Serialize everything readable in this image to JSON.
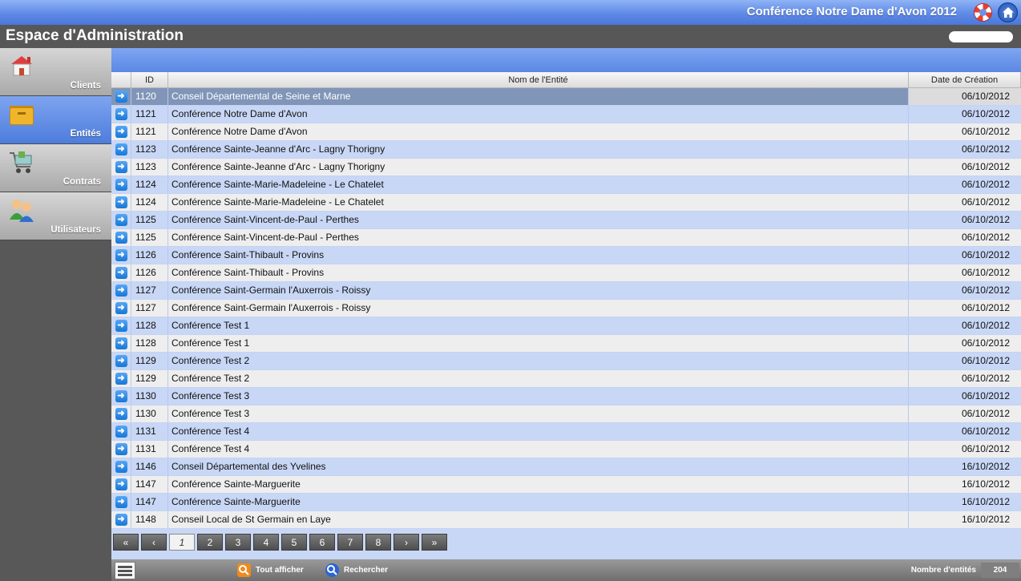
{
  "app": {
    "title": "Conférence Notre Dame d'Avon 2012",
    "page_title": "Espace d'Administration"
  },
  "sidebar": {
    "items": [
      {
        "label": "Clients",
        "icon": "house-icon"
      },
      {
        "label": "Entités",
        "icon": "folder-icon"
      },
      {
        "label": "Contrats",
        "icon": "cart-icon"
      },
      {
        "label": "Utilisateurs",
        "icon": "users-icon"
      }
    ]
  },
  "table": {
    "columns": [
      "ID",
      "Nom de l'Entité",
      "Date de Création"
    ],
    "rows": [
      {
        "id": "1120",
        "name": "Conseil Départemental de Seine et Marne",
        "date": "06/10/2012"
      },
      {
        "id": "1121",
        "name": "Conférence Notre Dame d'Avon",
        "date": "06/10/2012"
      },
      {
        "id": "1121",
        "name": "Conférence Notre Dame d'Avon",
        "date": "06/10/2012"
      },
      {
        "id": "1123",
        "name": "Conférence Sainte-Jeanne d'Arc - Lagny Thorigny",
        "date": "06/10/2012"
      },
      {
        "id": "1123",
        "name": "Conférence Sainte-Jeanne d'Arc - Lagny Thorigny",
        "date": "06/10/2012"
      },
      {
        "id": "1124",
        "name": "Conférence Sainte-Marie-Madeleine - Le Chatelet",
        "date": "06/10/2012"
      },
      {
        "id": "1124",
        "name": "Conférence Sainte-Marie-Madeleine - Le Chatelet",
        "date": "06/10/2012"
      },
      {
        "id": "1125",
        "name": "Conférence Saint-Vincent-de-Paul - Perthes",
        "date": "06/10/2012"
      },
      {
        "id": "1125",
        "name": "Conférence Saint-Vincent-de-Paul - Perthes",
        "date": "06/10/2012"
      },
      {
        "id": "1126",
        "name": "Conférence Saint-Thibault - Provins",
        "date": "06/10/2012"
      },
      {
        "id": "1126",
        "name": "Conférence Saint-Thibault - Provins",
        "date": "06/10/2012"
      },
      {
        "id": "1127",
        "name": "Conférence Saint-Germain l'Auxerrois - Roissy",
        "date": "06/10/2012"
      },
      {
        "id": "1127",
        "name": "Conférence Saint-Germain l'Auxerrois - Roissy",
        "date": "06/10/2012"
      },
      {
        "id": "1128",
        "name": "Conférence Test 1",
        "date": "06/10/2012"
      },
      {
        "id": "1128",
        "name": "Conférence Test 1",
        "date": "06/10/2012"
      },
      {
        "id": "1129",
        "name": "Conférence Test 2",
        "date": "06/10/2012"
      },
      {
        "id": "1129",
        "name": "Conférence Test 2",
        "date": "06/10/2012"
      },
      {
        "id": "1130",
        "name": "Conférence Test 3",
        "date": "06/10/2012"
      },
      {
        "id": "1130",
        "name": "Conférence Test 3",
        "date": "06/10/2012"
      },
      {
        "id": "1131",
        "name": "Conférence Test 4",
        "date": "06/10/2012"
      },
      {
        "id": "1131",
        "name": "Conférence Test 4",
        "date": "06/10/2012"
      },
      {
        "id": "1146",
        "name": "Conseil Départemental des Yvelines",
        "date": "16/10/2012"
      },
      {
        "id": "1147",
        "name": "Conférence Sainte-Marguerite",
        "date": "16/10/2012"
      },
      {
        "id": "1147",
        "name": "Conférence Sainte-Marguerite",
        "date": "16/10/2012"
      },
      {
        "id": "1148",
        "name": "Conseil Local de St Germain en Laye",
        "date": "16/10/2012"
      }
    ]
  },
  "pager": {
    "first": "«",
    "prev": "‹",
    "pages": [
      "1",
      "2",
      "3",
      "4",
      "5",
      "6",
      "7",
      "8"
    ],
    "current": "1",
    "next": "›",
    "last": "»"
  },
  "toolbar": {
    "show_all": "Tout afficher",
    "search": "Rechercher",
    "count_label": "Nombre d'entités",
    "count_value": "204"
  }
}
